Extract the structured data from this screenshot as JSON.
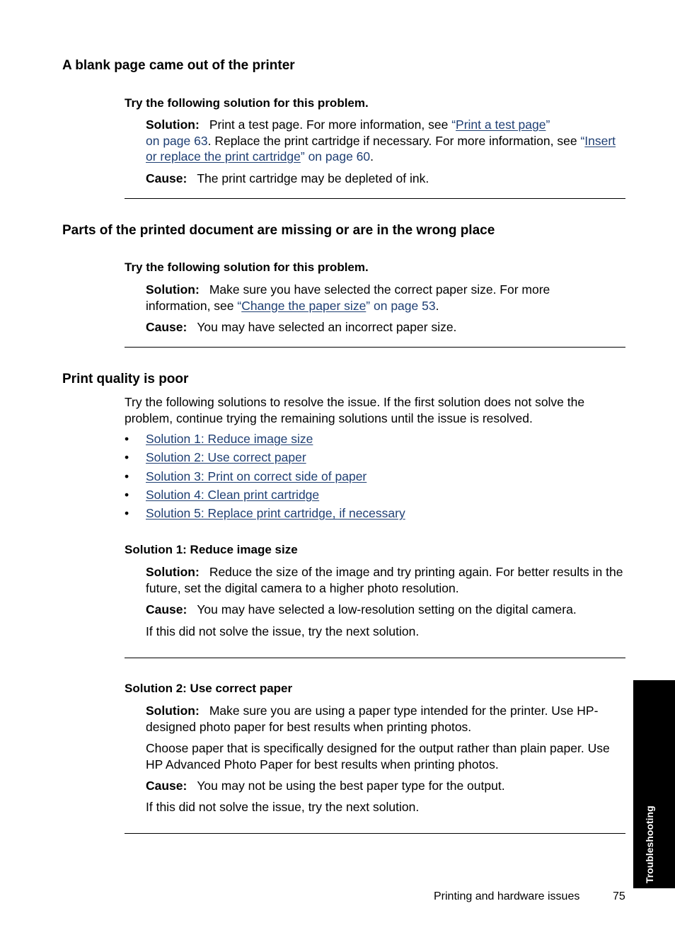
{
  "sections": [
    {
      "title": "A blank page came out of the printer",
      "try_label": "Try the following solution for this problem.",
      "solution_label": "Solution:",
      "solution_line1_text": "Print a test page. For more information, see ",
      "solution_link1_open": "“",
      "solution_link1": "Print a test page",
      "solution_link1_close": "”",
      "solution_line2_ref": "on page 63",
      "solution_line2_text": ". Replace the print cartridge if necessary. For more information, see ",
      "solution_link2_open": "“",
      "solution_link2a": "Insert",
      "solution_link2b": "or replace the print cartridge",
      "solution_link2_close": "” on page 60",
      "solution_end": ".",
      "cause_label": "Cause:",
      "cause_text": "The print cartridge may be depleted of ink."
    },
    {
      "title": "Parts of the printed document are missing or are in the wrong place",
      "try_label": "Try the following solution for this problem.",
      "solution_label": "Solution:",
      "solution_line1_text": "Make sure you have selected the correct paper size. For more",
      "solution_line2_text": "information, see ",
      "solution_link_open": "“",
      "solution_link": "Change the paper size",
      "solution_link_close": "” on page 53",
      "solution_end": ".",
      "cause_label": "Cause:",
      "cause_text": "You may have selected an incorrect paper size."
    },
    {
      "title": "Print quality is poor",
      "intro": "Try the following solutions to resolve the issue. If the first solution does not solve the problem, continue trying the remaining solutions until the issue is resolved.",
      "bullet_glyph": "•",
      "links": [
        "Solution 1: Reduce image size",
        "Solution 2: Use correct paper",
        "Solution 3: Print on correct side of paper",
        "Solution 4: Clean print cartridge",
        "Solution 5: Replace print cartridge, if necessary"
      ],
      "subsections": [
        {
          "title": "Solution 1: Reduce image size",
          "solution_label": "Solution:",
          "solution_text": "Reduce the size of the image and try printing again. For better results in the future, set the digital camera to a higher photo resolution.",
          "cause_label": "Cause:",
          "cause_text": "You may have selected a low-resolution setting on the digital camera.",
          "next": "If this did not solve the issue, try the next solution."
        },
        {
          "title": "Solution 2: Use correct paper",
          "solution_label": "Solution:",
          "solution_text": "Make sure you are using a paper type intended for the printer. Use HP-designed photo paper for best results when printing photos.",
          "extra_paragraph": "Choose paper that is specifically designed for the output rather than plain paper. Use HP Advanced Photo Paper for best results when printing photos.",
          "cause_label": "Cause:",
          "cause_text": "You may not be using the best paper type for the output.",
          "next": "If this did not solve the issue, try the next solution."
        }
      ]
    }
  ],
  "side_tab": {
    "label": "Troubleshooting",
    "background": "#000000",
    "text_color": "#ffffff"
  },
  "footer": {
    "chapter": "Printing and hardware issues",
    "page_number": "75"
  },
  "colors": {
    "link": "#1f3f73",
    "text": "#000000"
  }
}
